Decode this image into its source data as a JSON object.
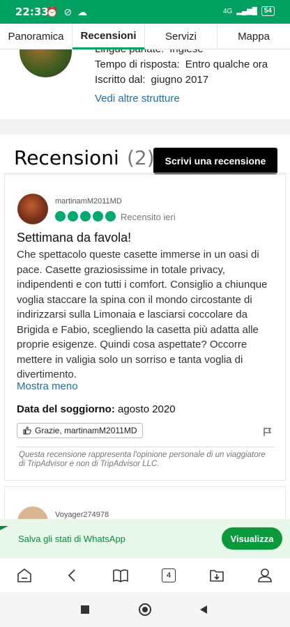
{
  "status": {
    "time": "22:33",
    "network": "4G",
    "battery": "54"
  },
  "tabs": [
    {
      "label": "Panoramica"
    },
    {
      "label": "Recensioni"
    },
    {
      "label": "Servizi"
    },
    {
      "label": "Mappa"
    }
  ],
  "host": {
    "languages_label": "Lingue parlate:",
    "languages_value": "Inglese",
    "response_label": "Tempo di risposta:",
    "response_value": "Entro qualche ora",
    "joined_label": "Iscritto dal:",
    "joined_value": "giugno 2017",
    "more_link": "Vedi altre strutture"
  },
  "reviews": {
    "title": "Recensioni",
    "count": "(2)",
    "write_button": "Scrivi una recensione"
  },
  "review": {
    "username": "martinamM2011MD",
    "rating": 5,
    "reviewed_when": "Recensito ieri",
    "title": "Settimana da favola!",
    "body": "Che spettacolo queste casette immerse in un oasi di pace. Casette graziosissime in totale privacy, indipendenti e con tutti i comfort. Consiglio a chiunque voglia staccare la spina con il mondo circostante di indirizzarsi sulla Limonaia e lasciarsi coccolare da Brigida e Fabio, scegliendo la casetta più adatta alle proprie esigenze. Quindi cosa aspettate? Occorre mettere in valigia solo un sorriso e tanta voglia di divertimento.",
    "show_less": "Mostra meno",
    "stay_label": "Data del soggiorno:",
    "stay_value": "agosto 2020",
    "thanks_button": "Grazie, martinamM2011MD",
    "disclaimer": "Questa recensione rappresenta l'opinione personale di un viaggiatore di TripAdvisor e non di TripAdvisor LLC."
  },
  "next_review": {
    "username": "Voyager274978"
  },
  "whatsapp": {
    "text": "Salva gli stati di WhatsApp",
    "button": "Visualizza"
  },
  "browser": {
    "tab_count": "4"
  },
  "colors": {
    "brand_green": "#00a060",
    "bubble_green": "#00aa6c",
    "link_blue": "#1a6fb0"
  }
}
